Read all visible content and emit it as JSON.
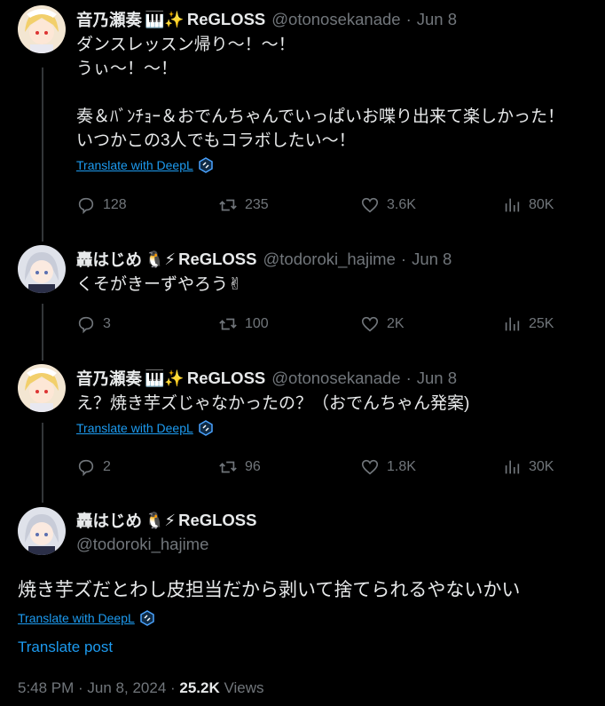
{
  "tweets": [
    {
      "name": "音乃瀬奏",
      "emojis": "🎹✨",
      "group": "ReGLOSS",
      "handle": "@otonosekanade",
      "sep": "·",
      "date": "Jun 8",
      "text": "ダンスレッスン帰り～！～！\nうぃ～！～！\n\n奏＆ﾊﾞﾝﾁｮｰ＆おでんちゃんでいっぱいお喋り出来て楽しかった！\nいつかこの3人でもコラボしたい～！",
      "translate": "Translate with DeepL",
      "replies": "128",
      "reposts": "235",
      "likes": "3.6K",
      "views": "80K"
    },
    {
      "name": "轟はじめ",
      "emojis": "🐧⚡",
      "group": "ReGLOSS",
      "handle": "@todoroki_hajime",
      "sep": "·",
      "date": "Jun 8",
      "text": "くそがきーずやろう✌",
      "replies": "3",
      "reposts": "100",
      "likes": "2K",
      "views": "25K"
    },
    {
      "name": "音乃瀬奏",
      "emojis": "🎹✨",
      "group": "ReGLOSS",
      "handle": "@otonosekanade",
      "sep": "·",
      "date": "Jun 8",
      "text": "え？焼き芋ズじゃなかったの？（おでんちゃん発案)",
      "translate": "Translate with DeepL",
      "replies": "2",
      "reposts": "96",
      "likes": "1.8K",
      "views": "30K"
    }
  ],
  "main": {
    "name": "轟はじめ",
    "emojis": "🐧⚡",
    "group": "ReGLOSS",
    "handle": "@todoroki_hajime",
    "text": "焼き芋ズだとわし皮担当だから剥いて捨てられるやないかい",
    "translate": "Translate with DeepL",
    "translate_post": "Translate post",
    "time": "5:48 PM · Jun 8, 2024 · ",
    "views_count": "25.2K",
    "views_label": " Views"
  }
}
